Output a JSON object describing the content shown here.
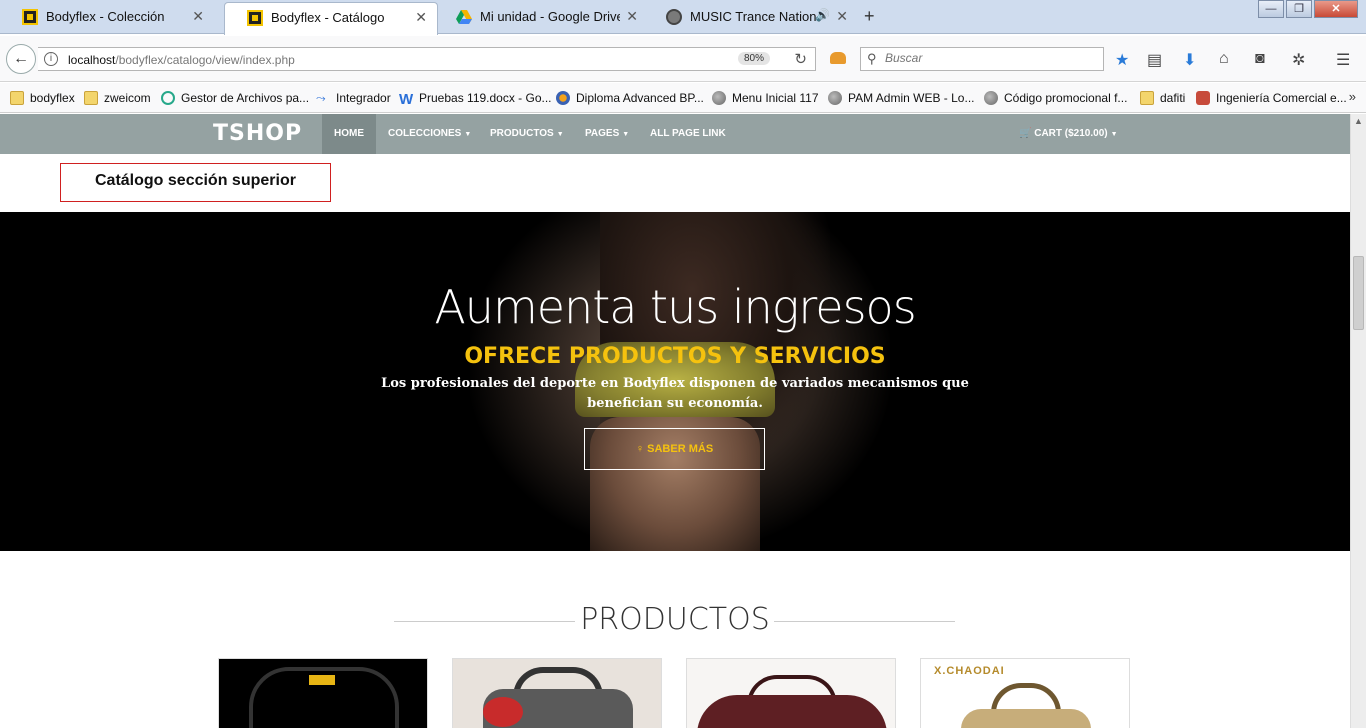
{
  "browser": {
    "tabs": [
      {
        "title": "Bodyflex - Colección",
        "close": "✕"
      },
      {
        "title": "Bodyflex - Catálogo",
        "close": "✕"
      },
      {
        "title": "Mi unidad - Google Drive",
        "close": "✕"
      },
      {
        "title": "MUSIC Trance Nation Ne",
        "close": "✕",
        "audio": "🔊"
      }
    ],
    "new_tab": "+",
    "window_buttons": {
      "minimize": "—",
      "maximize": "❐",
      "close": "✕"
    },
    "url": {
      "host": "localhost",
      "path": "/bodyflex/catalogo/view/index.php"
    },
    "zoom": "80%",
    "search_placeholder": "Buscar",
    "bookmarks": [
      {
        "label": "bodyflex",
        "icon": "folder-icon"
      },
      {
        "label": "zweicom",
        "icon": "folder-icon"
      },
      {
        "label": "Gestor de Archivos pa...",
        "icon": "archive-icon"
      },
      {
        "label": "Integrador",
        "icon": "integrator-icon"
      },
      {
        "label": "Pruebas 119.docx - Go...",
        "icon": "word-icon"
      },
      {
        "label": "Diploma Advanced BP...",
        "icon": "orange-globe-icon"
      },
      {
        "label": "Menu Inicial 117",
        "icon": "globe-icon"
      },
      {
        "label": "PAM Admin WEB - Lo...",
        "icon": "globe-icon"
      },
      {
        "label": "Código promocional f...",
        "icon": "globe-icon"
      },
      {
        "label": "dafiti",
        "icon": "folder-icon"
      },
      {
        "label": "Ingeniería Comercial e...",
        "icon": "ing-icon"
      }
    ],
    "bookmarks_more": "»"
  },
  "shop": {
    "logo": "TSHOP",
    "nav": [
      {
        "label": "HOME",
        "caret": ""
      },
      {
        "label": "COLECCIONES",
        "caret": "▼"
      },
      {
        "label": "PRODUCTOS",
        "caret": "▼"
      },
      {
        "label": "PAGES",
        "caret": "▼"
      },
      {
        "label": "ALL PAGE LINK",
        "caret": ""
      }
    ],
    "cart": {
      "label": "CART ($210.00)",
      "caret": "▼"
    }
  },
  "section_label": "Catálogo sección superior",
  "hero": {
    "title": "Aumenta tus ingresos",
    "subtitle": "OFRECE PRODUCTOS Y SERVICIOS",
    "text": "Los profesionales del deporte en Bodyflex disponen de variados mecanismos que benefician su economía.",
    "button": "♀ SABER MÁS"
  },
  "products": {
    "title": "PRODUCTOS",
    "brand_on_fourth": "X.CHAODAI"
  }
}
